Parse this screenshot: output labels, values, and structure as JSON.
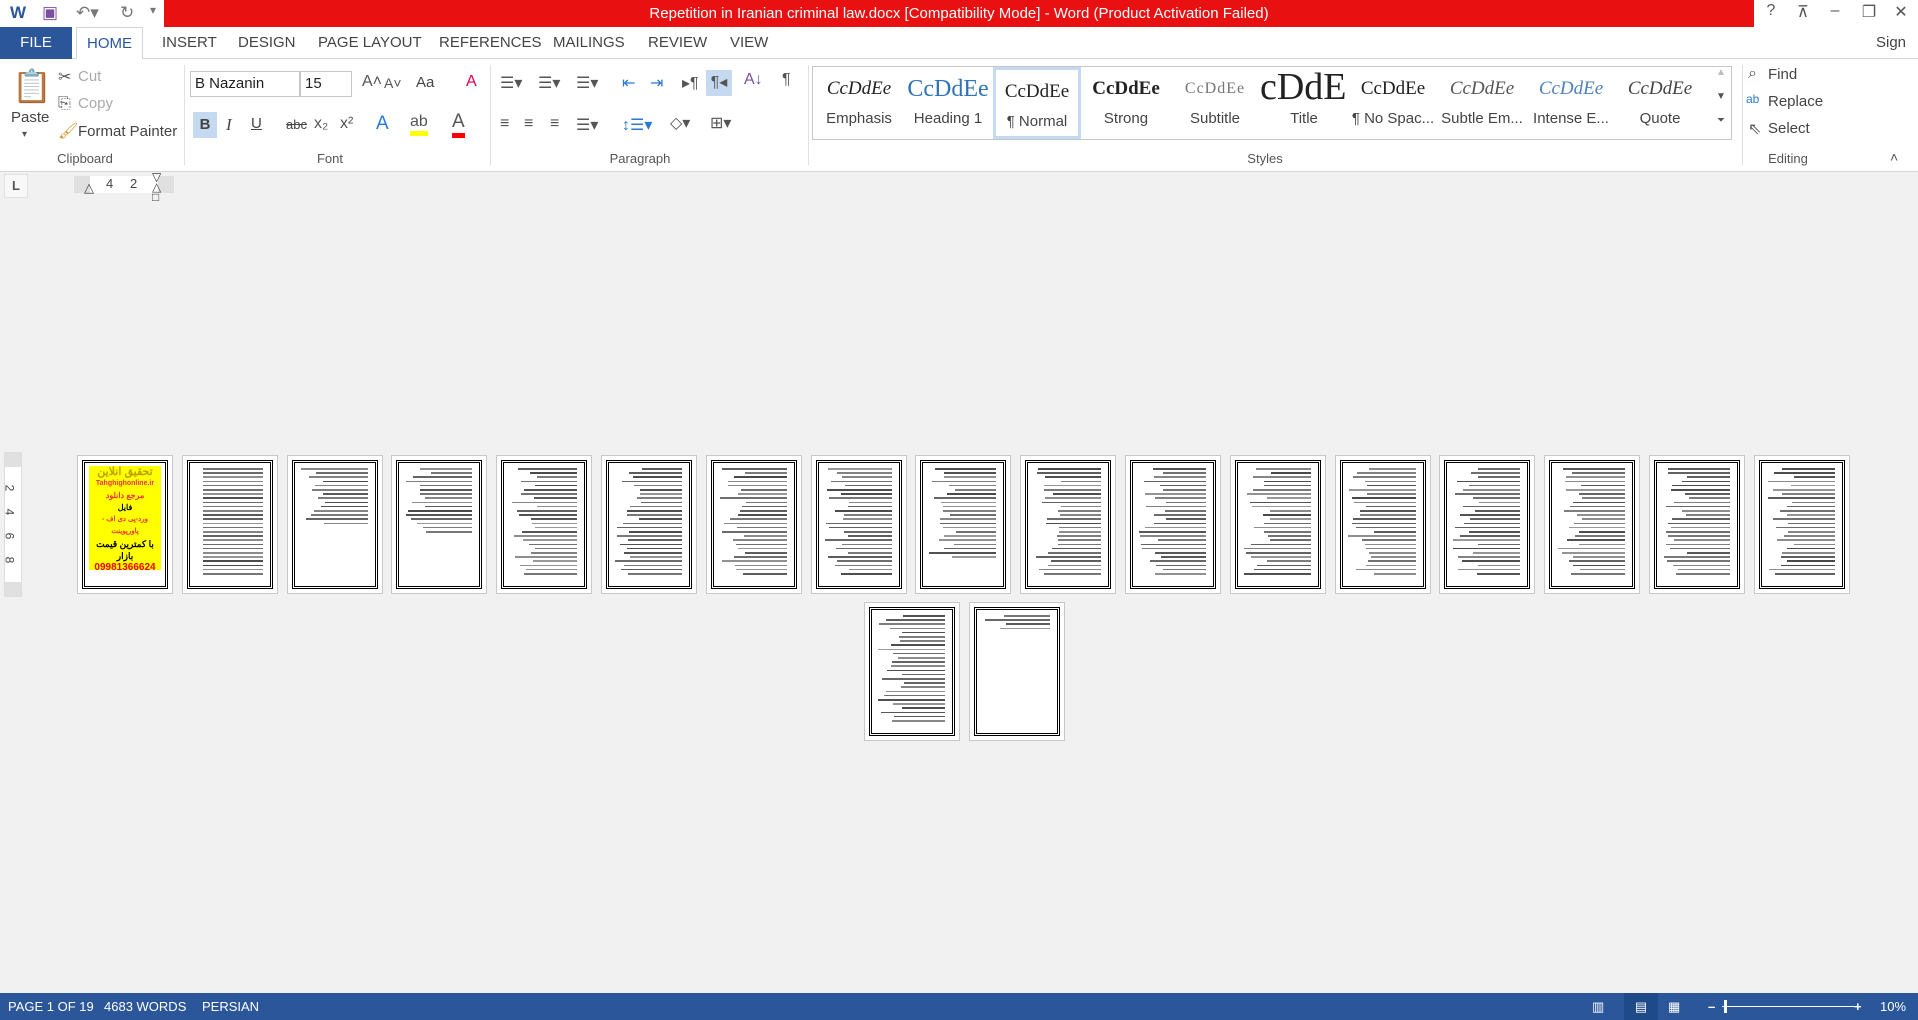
{
  "window": {
    "title": "Repetition in Iranian criminal law.docx [Compatibility Mode] -  Word (Product Activation Failed)",
    "help": "?",
    "controls": [
      "restore-ribbon",
      "minimize",
      "restore",
      "close"
    ],
    "sign_in": "Sign in"
  },
  "tabs": [
    "FILE",
    "HOME",
    "INSERT",
    "DESIGN",
    "PAGE LAYOUT",
    "REFERENCES",
    "MAILINGS",
    "REVIEW",
    "VIEW"
  ],
  "active_tab": "HOME",
  "clipboard": {
    "paste": "Paste",
    "cut": "Cut",
    "copy": "Copy",
    "format_painter": "Format Painter",
    "label": "Clipboard"
  },
  "font": {
    "name": "B Nazanin",
    "size": "15",
    "label": "Font",
    "case": "Aa",
    "bold": "B",
    "italic": "I",
    "underline": "U",
    "strike": "abc",
    "highlight_color": "#ffff00",
    "font_color": "#ff0000"
  },
  "paragraph": {
    "label": "Paragraph"
  },
  "styles": {
    "label": "Styles",
    "items": [
      {
        "preview": "CcDdEe",
        "name": "Emphasis"
      },
      {
        "preview": "CcDdEe",
        "name": "Heading 1"
      },
      {
        "preview": "CcDdEe",
        "name": "¶ Normal",
        "selected": true
      },
      {
        "preview": "CcDdEe",
        "name": "Strong"
      },
      {
        "preview": "CcDdEe",
        "name": "Subtitle"
      },
      {
        "preview": "cDdEe",
        "name": "Title"
      },
      {
        "preview": "CcDdEe",
        "name": "¶ No Spac..."
      },
      {
        "preview": "CcDdEe",
        "name": "Subtle Em..."
      },
      {
        "preview": "CcDdEe",
        "name": "Intense E..."
      },
      {
        "preview": "CcDdEe",
        "name": "Quote"
      }
    ]
  },
  "editing": {
    "label": "Editing",
    "find": "Find",
    "replace": "Replace",
    "select": "Select"
  },
  "ruler": {
    "tab_selector": "L",
    "h_ticks": [
      "4",
      "2"
    ],
    "v_ticks": [
      "2",
      "4",
      "6",
      "8"
    ]
  },
  "document": {
    "page_count": 19,
    "cover": {
      "brand": "تحقیق آنلاین",
      "site": "Tahghighonline.ir",
      "line1": "مرجع دانلود",
      "line2": "فایل",
      "line3": "ورد-پی دی اف - پاورپوینت",
      "line4": "با کمترین قیمت بازار",
      "phone": "09981366624 واتساپ",
      "bg": "#ffff00"
    }
  },
  "status": {
    "page": "PAGE 1 OF 19",
    "words": "4683 WORDS",
    "language": "PERSIAN",
    "zoom": "10%",
    "zoom_percent": 10
  }
}
